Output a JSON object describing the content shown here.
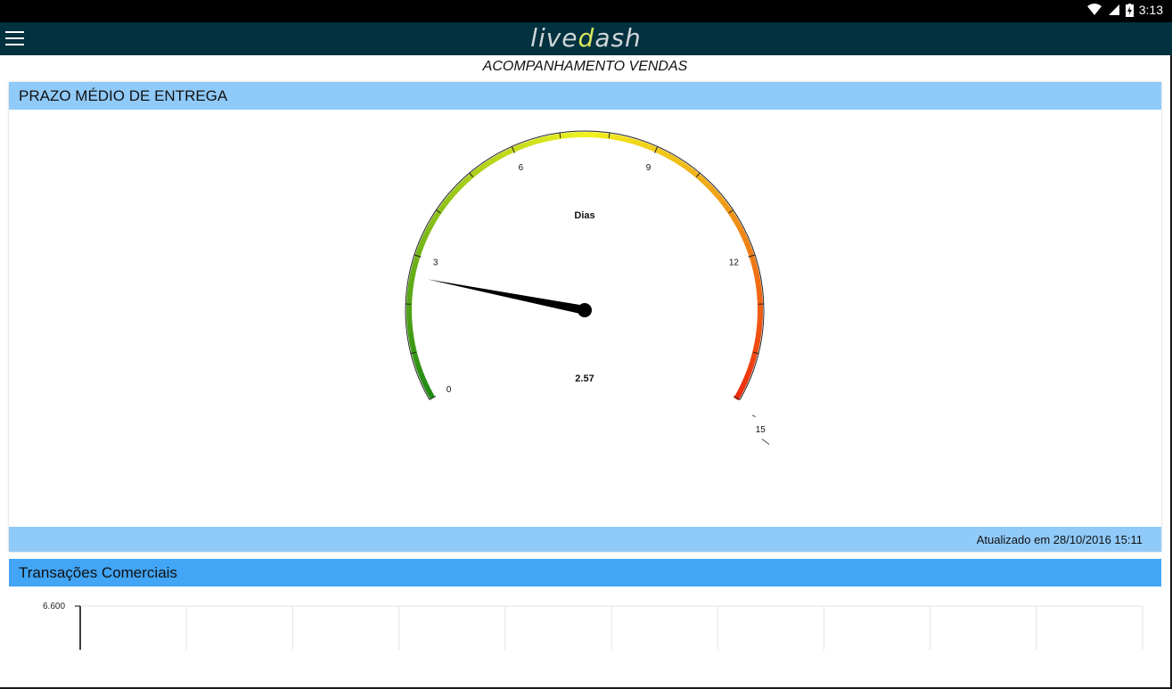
{
  "status_bar": {
    "time": "3:13",
    "icons": [
      "wifi-icon",
      "signal-icon",
      "battery-icon"
    ]
  },
  "app_bar": {
    "menu_icon": "hamburger-menu-icon",
    "logo_prefix": "live",
    "logo_accent": "d",
    "logo_suffix": "ash"
  },
  "page": {
    "title": "ACOMPANHAMENTO VENDAS"
  },
  "gauge_card": {
    "title": "PRAZO MÉDIO DE ENTREGA",
    "updated": "Atualizado em 28/10/2016 15:11",
    "gauge": {
      "unit_label": "Dias",
      "value": 2.57,
      "value_label": "2.57",
      "min": 0,
      "max": 15,
      "tick_labels": [
        "0",
        "3",
        "6",
        "9",
        "12",
        "15"
      ],
      "colors": {
        "low": "#1e8a14",
        "mid": "#f1f21e",
        "high": "#ee2a0e"
      }
    }
  },
  "chart_card": {
    "title": "Transações Comerciais",
    "y_tick_top": "6.600"
  },
  "colors": {
    "app_bar": "#023140",
    "card_header": "#90caf9",
    "card2_header": "#42a5f5"
  }
}
